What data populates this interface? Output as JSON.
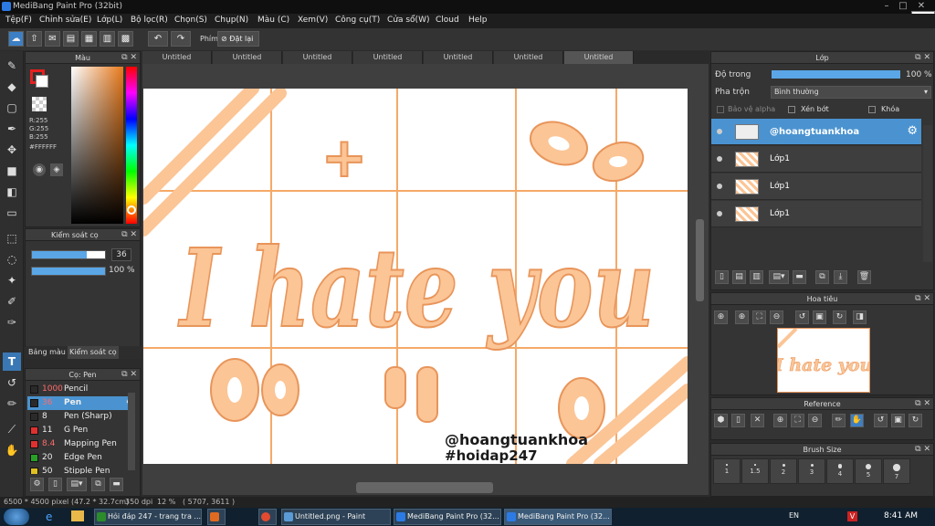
{
  "window": {
    "title": "MediBang Paint Pro (32bit)",
    "close_tooltip": "Close"
  },
  "menu": [
    "Tệp(F)",
    "Chỉnh sửa(E)",
    "Lớp(L)",
    "Bộ lọc(R)",
    "Chọn(S)",
    "Chụp(N)",
    "Màu (C)",
    "Xem(V)",
    "Công cụ(T)",
    "Cửa sổ(W)",
    "Cloud",
    "Help"
  ],
  "toolbar": {
    "shortcut_label": "Phím",
    "reset_label": "Đặt lại"
  },
  "color_panel": {
    "title": "Màu",
    "r": "R:255",
    "g": "G:255",
    "b": "B:255",
    "hex": "#FFFFFF",
    "fg": "#e62020",
    "bg": "#ffffff"
  },
  "brush_control": {
    "title": "Kiểm soát cọ",
    "size": "36",
    "opacity": "100 %",
    "size_fraction": 0.75,
    "opacity_fraction": 1.0
  },
  "left_tabs": [
    "Bảng màu",
    "Kiểm soát cọ"
  ],
  "brush_panel": {
    "title": "Cọ: Pen",
    "items": [
      {
        "size": "1000",
        "name": "Pencil",
        "color": "#2a2a2a",
        "size_color": "#ff6b6b"
      },
      {
        "size": "36",
        "name": "Pen",
        "color": "#2a2a2a",
        "size_color": "#ff6b6b",
        "selected": true
      },
      {
        "size": "8",
        "name": "Pen (Sharp)",
        "color": "#2a2a2a",
        "size_color": "#eeeeee"
      },
      {
        "size": "11",
        "name": "G Pen",
        "color": "#e03030",
        "size_color": "#eeeeee"
      },
      {
        "size": "8.4",
        "name": "Mapping Pen",
        "color": "#e03030",
        "size_color": "#ff6b6b"
      },
      {
        "size": "20",
        "name": "Edge Pen",
        "color": "#28a028",
        "size_color": "#eeeeee"
      },
      {
        "size": "50",
        "name": "Stipple Pen",
        "color": "#e0c020",
        "size_color": "#eeeeee"
      }
    ]
  },
  "tabs": [
    "Untitled",
    "Untitled",
    "Untitled",
    "Untitled",
    "Untitled",
    "Untitled",
    "Untitled"
  ],
  "artwork": {
    "main": "I hate you",
    "handle": "@hoangtuankhoa",
    "tag": "#hoidap247",
    "plus": "+"
  },
  "layer_panel": {
    "title": "Lớp",
    "opacity_label": "Độ trong",
    "opacity_value": "100 %",
    "blend_label": "Pha trộn",
    "blend_value": "Bình thường",
    "alpha_label": "Bảo vệ alpha",
    "clip_label": "Xén bớt",
    "lock_label": "Khóa",
    "layers": [
      {
        "name": "@hoangtuankhoa",
        "selected": true
      },
      {
        "name": "Lớp1"
      },
      {
        "name": "Lớp1"
      },
      {
        "name": "Lớp1"
      }
    ]
  },
  "navigator": {
    "title": "Hoa tiêu"
  },
  "reference": {
    "title": "Reference"
  },
  "brush_size": {
    "title": "Brush Size",
    "labels": [
      "1",
      "1.5",
      "2",
      "3",
      "4",
      "5",
      "7"
    ]
  },
  "status": {
    "dims": "6500 * 4500 pixel",
    "cm": "(47.2 * 32.7cm)",
    "dpi": "350 dpi",
    "zoom": "12 %",
    "coords": "( 5707, 3611 )"
  },
  "taskbar": {
    "items": [
      "Hỏi đáp 247 - trang tra ...",
      "",
      "",
      "Untitled.png - Paint",
      "MediBang Paint Pro (32...",
      "MediBang Paint Pro (32..."
    ],
    "lang": "EN",
    "time": "8:41 AM"
  }
}
